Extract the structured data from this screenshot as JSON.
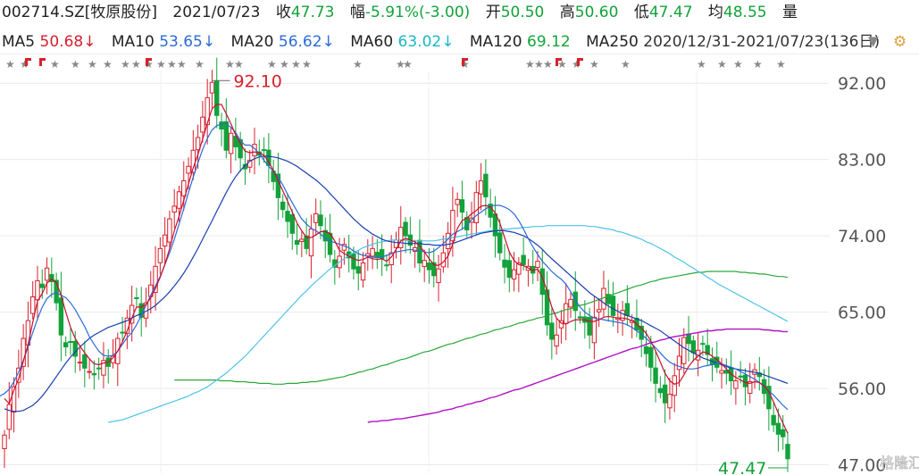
{
  "header": {
    "code": "002714.SZ[牧原股份]",
    "date": "2021/07/23",
    "close_label": "收",
    "close": "47.73",
    "change_label": "幅",
    "change": "-5.91%(-3.00)",
    "open_label": "开",
    "open": "50.50",
    "high_label": "高",
    "high": "50.60",
    "low_label": "低",
    "low": "47.47",
    "avg_label": "均",
    "avg": "48.55",
    "vol_label": "量"
  },
  "ma_row": {
    "items": [
      {
        "label": "MA5",
        "value": "50.68↓"
      },
      {
        "label": "MA10",
        "value": "53.65↓"
      },
      {
        "label": "MA20",
        "value": "56.62↓"
      },
      {
        "label": "MA60",
        "value": "63.02↓"
      },
      {
        "label": "MA120",
        "value": "69.12"
      }
    ],
    "range": "2020/12/31-2021/07/23(136日)",
    "ma250": "MA250",
    "down_btn": "▼",
    "settings_btn": "⚙"
  },
  "colors": {
    "up": "#d7202c",
    "down": "#13a23a",
    "ma5": "#c8102e",
    "ma10": "#2c6bd8",
    "ma20": "#1a3fb0",
    "ma60": "#4fc3e8",
    "ma120": "#2aa83a",
    "ma250": "#b012c4"
  },
  "chart_data": {
    "type": "candlestick",
    "y_ticks": [
      92.0,
      83.0,
      74.0,
      65.0,
      56.0,
      47.0
    ],
    "ylim": [
      46.0,
      95.5
    ],
    "max_label": "92.10",
    "min_label": "47.47",
    "watermark": "格隆汇",
    "closes": [
      50.5,
      54.1,
      56.2,
      58.4,
      61.9,
      64.0,
      66.8,
      68.7,
      67.9,
      70.2,
      68.6,
      66.1,
      62.3,
      60.9,
      61.5,
      59.8,
      59.1,
      58.4,
      58.0,
      57.6,
      58.4,
      59.3,
      58.6,
      59.8,
      61.9,
      62.6,
      64.3,
      65.8,
      66.6,
      64.4,
      66.1,
      68.2,
      70.4,
      72.5,
      74.1,
      76.0,
      77.5,
      79.2,
      80.5,
      82.2,
      84.1,
      85.6,
      88.0,
      90.3,
      92.1,
      88.2,
      86.6,
      84.1,
      86.1,
      84.5,
      83.2,
      81.9,
      82.9,
      84.8,
      83.5,
      84.1,
      82.3,
      80.4,
      78.5,
      77.1,
      75.7,
      74.3,
      73.0,
      73.6,
      72.5,
      74.8,
      76.6,
      75.2,
      73.4,
      71.8,
      70.3,
      71.6,
      73.0,
      71.4,
      70.1,
      69.6,
      70.8,
      71.9,
      72.5,
      71.5,
      71.3,
      70.5,
      72.0,
      73.5,
      75.0,
      74.0,
      72.9,
      72.6,
      70.8,
      71.1,
      70.0,
      69.3,
      70.1,
      72.0,
      74.3,
      77.0,
      78.3,
      76.8,
      74.7,
      76.1,
      79.1,
      80.5,
      78.6,
      76.2,
      74.0,
      72.0,
      70.3,
      69.1,
      70.0,
      70.8,
      70.6,
      70.4,
      69.6,
      71.0,
      67.1,
      63.5,
      61.8,
      62.3,
      64.0,
      66.0,
      66.5,
      65.2,
      64.3,
      63.8,
      62.3,
      64.4,
      65.3,
      67.8,
      66.0,
      64.6,
      64.3,
      65.2,
      64.6,
      64.0,
      62.9,
      61.8,
      60.1,
      58.5,
      56.6,
      55.5,
      54.3,
      55.3,
      57.5,
      59.8,
      62.0,
      61.3,
      60.2,
      60.5,
      61.3,
      60.0,
      58.8,
      58.5,
      58.1,
      57.8,
      56.9,
      56.9,
      57.4,
      56.2,
      56.8,
      58.2,
      57.4,
      55.4,
      53.6,
      51.7,
      50.6,
      50.3,
      47.7
    ],
    "ma5": [
      54.8,
      54.2,
      55.8,
      57.1,
      59.2,
      61.2,
      63.8,
      66.3,
      67.2,
      68.4,
      68.9,
      68.5,
      67.0,
      65.0,
      63.2,
      61.9,
      61.0,
      60.2,
      59.5,
      58.9,
      58.8,
      59.0,
      59.1,
      59.6,
      60.4,
      61.5,
      62.8,
      64.3,
      65.6,
      65.6,
      65.9,
      66.7,
      67.8,
      69.1,
      70.6,
      72.5,
      74.6,
      76.3,
      78.2,
      80.1,
      82.0,
      83.6,
      85.4,
      87.3,
      89.0,
      89.5,
      89.5,
      88.4,
      87.2,
      85.9,
      84.9,
      84.0,
      83.8,
      83.9,
      83.8,
      83.5,
      82.7,
      81.7,
      80.5,
      79.3,
      78.1,
      76.8,
      75.5,
      74.6,
      73.8,
      73.8,
      74.1,
      74.5,
      74.5,
      74.3,
      73.4,
      72.3,
      71.9,
      71.6,
      71.3,
      71.1,
      71.2,
      71.5,
      71.3,
      71.2,
      71.3,
      71.0,
      71.5,
      72.4,
      73.4,
      73.7,
      73.5,
      73.3,
      72.8,
      72.1,
      71.3,
      70.6,
      70.5,
      70.9,
      71.6,
      73.0,
      74.9,
      75.8,
      76.1,
      76.6,
      77.0,
      77.5,
      77.6,
      77.4,
      76.7,
      75.5,
      73.8,
      72.1,
      71.1,
      70.6,
      70.5,
      70.2,
      69.9,
      70.1,
      69.1,
      67.5,
      65.6,
      64.3,
      63.7,
      63.6,
      63.9,
      64.1,
      64.1,
      64.1,
      63.9,
      63.9,
      64.1,
      64.4,
      64.5,
      64.4,
      64.3,
      64.3,
      64.2,
      64.0,
      63.6,
      63.1,
      62.5,
      61.6,
      60.4,
      59.1,
      57.8,
      56.9,
      56.5,
      56.7,
      57.6,
      58.6,
      59.3,
      59.8,
      60.3,
      60.2,
      59.8,
      59.4,
      58.9,
      58.3,
      57.7,
      57.3,
      57.0,
      56.7,
      56.6,
      56.8,
      56.7,
      56.3,
      55.6,
      54.4,
      53.1,
      51.9,
      50.7
    ],
    "ma10": [
      55.6,
      55.1,
      55.4,
      55.9,
      56.8,
      57.9,
      59.3,
      60.9,
      62.6,
      64.2,
      65.6,
      66.6,
      67.1,
      67.3,
      67.0,
      66.7,
      66.1,
      65.3,
      64.3,
      63.3,
      62.1,
      61.2,
      60.4,
      59.9,
      59.8,
      59.9,
      60.4,
      61.2,
      62.0,
      62.6,
      63.5,
      64.6,
      65.8,
      67.0,
      68.1,
      69.2,
      70.6,
      72.0,
      73.6,
      75.4,
      77.2,
      79.1,
      80.9,
      82.6,
      84.2,
      85.5,
      86.5,
      87.0,
      87.2,
      87.2,
      86.8,
      86.2,
      85.2,
      84.7,
      84.7,
      84.3,
      83.7,
      82.9,
      82.2,
      81.6,
      80.9,
      80.0,
      78.9,
      77.9,
      76.9,
      76.0,
      75.4,
      74.9,
      74.6,
      74.2,
      73.7,
      73.4,
      73.2,
      73.0,
      72.8,
      72.6,
      72.2,
      71.9,
      71.7,
      71.6,
      71.5,
      71.4,
      71.5,
      71.7,
      71.9,
      72.1,
      72.2,
      72.3,
      72.4,
      72.3,
      72.3,
      72.1,
      72.0,
      72.2,
      72.6,
      73.1,
      73.6,
      74.2,
      74.5,
      74.8,
      75.2,
      75.9,
      76.4,
      76.8,
      77.2,
      77.5,
      77.6,
      77.6,
      77.4,
      77.1,
      76.6,
      75.8,
      74.8,
      73.7,
      72.7,
      71.8,
      71.0,
      70.4,
      69.8,
      69.3,
      68.9,
      68.3,
      67.4,
      66.4,
      65.6,
      65.0,
      64.6,
      64.3,
      64.2,
      64.1,
      64.0,
      63.9,
      63.8,
      63.7,
      63.5,
      63.2,
      62.8,
      62.4,
      61.9,
      61.4,
      60.8,
      60.2,
      59.6,
      59.1,
      58.8,
      58.6,
      58.4,
      58.3,
      58.3,
      58.4,
      58.6,
      58.7,
      58.8,
      59.0,
      58.9,
      58.7,
      58.5,
      58.3,
      58.0,
      57.7,
      57.4,
      57.1,
      56.7,
      56.2,
      55.7,
      55.2,
      54.6,
      54.0,
      53.5
    ],
    "ma20": [
      53.6,
      53.4,
      53.3,
      53.3,
      53.4,
      53.7,
      54.0,
      54.5,
      55.1,
      55.8,
      56.6,
      57.4,
      58.2,
      59.0,
      59.7,
      60.3,
      60.9,
      61.4,
      61.9,
      62.3,
      62.6,
      62.9,
      63.2,
      63.4,
      63.6,
      63.8,
      64.0,
      64.3,
      64.6,
      64.8,
      65.1,
      65.4,
      65.8,
      66.3,
      66.8,
      67.4,
      68.1,
      68.8,
      69.6,
      70.5,
      71.5,
      72.5,
      73.6,
      74.7,
      75.8,
      76.9,
      78.0,
      79.1,
      80.1,
      81.0,
      81.7,
      82.3,
      82.8,
      83.1,
      83.3,
      83.4,
      83.4,
      83.3,
      83.2,
      83.0,
      82.8,
      82.5,
      82.2,
      81.8,
      81.4,
      81.0,
      80.6,
      80.1,
      79.6,
      79.0,
      78.4,
      77.8,
      77.2,
      76.6,
      76.0,
      75.5,
      75.0,
      74.6,
      74.2,
      73.9,
      73.6,
      73.4,
      73.3,
      73.2,
      73.2,
      73.1,
      73.1,
      73.1,
      73.1,
      73.0,
      73.0,
      72.9,
      72.9,
      72.9,
      73.0,
      73.1,
      73.3,
      73.5,
      73.7,
      73.9,
      74.1,
      74.3,
      74.4,
      74.5,
      74.6,
      74.6,
      74.6,
      74.5,
      74.4,
      74.2,
      74.0,
      73.7,
      73.3,
      72.9,
      72.4,
      71.8,
      71.3,
      70.8,
      70.3,
      69.8,
      69.3,
      68.8,
      68.3,
      67.8,
      67.3,
      66.9,
      66.5,
      66.1,
      65.7,
      65.4,
      65.1,
      64.8,
      64.6,
      64.4,
      64.2,
      64.0,
      63.7,
      63.4,
      63.1,
      62.8,
      62.4,
      62.0,
      61.6,
      61.2,
      60.8,
      60.5,
      60.2,
      59.9,
      59.6,
      59.4,
      59.2,
      59.0,
      58.8,
      58.6,
      58.4,
      58.3,
      58.2,
      58.1,
      58.0,
      57.9,
      57.8,
      57.6,
      57.4,
      57.2,
      57.0,
      56.8,
      56.6
    ],
    "ma60": [
      52.0,
      52.1,
      52.2,
      52.3,
      52.5,
      52.7,
      52.9,
      53.1,
      53.3,
      53.5,
      53.7,
      53.9,
      54.1,
      54.3,
      54.5,
      54.7,
      54.9,
      55.1,
      55.4,
      55.6,
      55.9,
      56.2,
      56.6,
      57.0,
      57.4,
      57.8,
      58.3,
      58.8,
      59.3,
      59.8,
      60.4,
      61.0,
      61.6,
      62.2,
      62.8,
      63.4,
      64.0,
      64.6,
      65.2,
      65.8,
      66.4,
      67.0,
      67.5,
      68.1,
      68.6,
      69.1,
      69.6,
      70.1,
      70.5,
      70.9,
      71.3,
      71.7,
      72.0,
      72.3,
      72.6,
      72.8,
      73.0,
      73.2,
      73.3,
      73.4,
      73.5,
      73.5,
      73.5,
      73.5,
      73.4,
      73.4,
      73.4,
      73.4,
      73.4,
      73.4,
      73.5,
      73.6,
      73.7,
      73.8,
      73.9,
      74.0,
      74.1,
      74.2,
      74.3,
      74.4,
      74.5,
      74.6,
      74.6,
      74.7,
      74.8,
      74.8,
      74.9,
      74.9,
      75.0,
      75.0,
      75.1,
      75.1,
      75.1,
      75.2,
      75.2,
      75.2,
      75.2,
      75.2,
      75.2,
      75.2,
      75.2,
      75.2,
      75.1,
      75.1,
      75.0,
      74.9,
      74.8,
      74.7,
      74.5,
      74.4,
      74.2,
      74.0,
      73.8,
      73.6,
      73.3,
      73.1,
      72.8,
      72.5,
      72.2,
      71.9,
      71.5,
      71.2,
      70.9,
      70.5,
      70.2,
      69.8,
      69.5,
      69.1,
      68.8,
      68.4,
      68.1,
      67.8,
      67.5,
      67.2,
      66.9,
      66.6,
      66.3,
      66.0,
      65.7,
      65.4,
      65.1,
      64.8,
      64.5,
      64.2,
      63.9
    ],
    "ma120": [
      57.0,
      57.0,
      57.0,
      57.0,
      57.0,
      57.0,
      57.0,
      57.0,
      57.0,
      57.0,
      56.9,
      56.9,
      56.9,
      56.8,
      56.8,
      56.8,
      56.7,
      56.7,
      56.6,
      56.6,
      56.6,
      56.5,
      56.5,
      56.5,
      56.6,
      56.6,
      56.6,
      56.7,
      56.7,
      56.8,
      56.8,
      56.9,
      57.0,
      57.1,
      57.2,
      57.3,
      57.4,
      57.6,
      57.7,
      57.9,
      58.0,
      58.2,
      58.3,
      58.5,
      58.7,
      58.8,
      59.0,
      59.2,
      59.4,
      59.5,
      59.7,
      59.9,
      60.1,
      60.3,
      60.4,
      60.6,
      60.8,
      61.0,
      61.2,
      61.3,
      61.5,
      61.7,
      61.9,
      62.0,
      62.2,
      62.4,
      62.5,
      62.7,
      62.9,
      63.0,
      63.2,
      63.3,
      63.5,
      63.7,
      63.8,
      64.0,
      64.1,
      64.3,
      64.4,
      64.6,
      64.8,
      64.9,
      65.1,
      65.3,
      65.4,
      65.6,
      65.8,
      65.9,
      66.1,
      66.3,
      66.5,
      66.7,
      66.9,
      67.1,
      67.3,
      67.5,
      67.7,
      67.9,
      68.1,
      68.2,
      68.4,
      68.6,
      68.7,
      68.9,
      69.0,
      69.1,
      69.2,
      69.3,
      69.4,
      69.5,
      69.6,
      69.7,
      69.7,
      69.8,
      69.8,
      69.8,
      69.8,
      69.8,
      69.8,
      69.8,
      69.7,
      69.7,
      69.6,
      69.6,
      69.5,
      69.5,
      69.4,
      69.3,
      69.2,
      69.2,
      69.1
    ],
    "ma250": [
      52.0,
      52.1,
      52.1,
      52.2,
      52.2,
      52.3,
      52.4,
      52.4,
      52.5,
      52.6,
      52.7,
      52.8,
      52.9,
      53.0,
      53.1,
      53.2,
      53.4,
      53.5,
      53.6,
      53.8,
      53.9,
      54.1,
      54.2,
      54.4,
      54.5,
      54.7,
      54.9,
      55.0,
      55.2,
      55.4,
      55.6,
      55.8,
      55.9,
      56.1,
      56.3,
      56.5,
      56.7,
      56.9,
      57.1,
      57.3,
      57.5,
      57.7,
      57.9,
      58.1,
      58.3,
      58.5,
      58.7,
      58.9,
      59.1,
      59.3,
      59.5,
      59.7,
      59.9,
      60.1,
      60.3,
      60.5,
      60.7,
      60.8,
      61.0,
      61.2,
      61.4,
      61.5,
      61.7,
      61.8,
      62.0,
      62.1,
      62.2,
      62.3,
      62.4,
      62.5,
      62.6,
      62.7,
      62.8,
      62.8,
      62.9,
      62.9,
      63.0,
      63.0,
      63.0,
      63.0,
      63.0,
      63.0,
      63.0,
      63.0,
      62.9,
      62.9,
      62.8,
      62.8,
      62.7,
      62.7
    ]
  }
}
